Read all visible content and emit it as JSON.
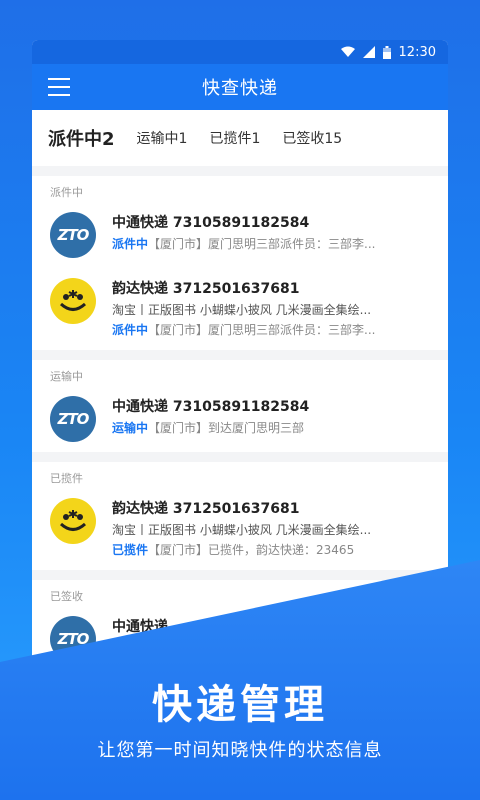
{
  "status_bar": {
    "time": "12:30"
  },
  "app": {
    "title": "快查快递"
  },
  "tabs": [
    {
      "label": "派件中2"
    },
    {
      "label": "运输中1"
    },
    {
      "label": "已揽件1"
    },
    {
      "label": "已签收15"
    }
  ],
  "sections": [
    {
      "title": "派件中",
      "items": [
        {
          "logo": "ZTO",
          "name": "中通快递 73105891182584",
          "status": "派件中",
          "location": "【厦门市】",
          "detail": "厦门思明三部派件员：三部李..."
        },
        {
          "logo": "Yunda",
          "name": "韵达快递 3712501637681",
          "desc": "淘宝丨正版图书  小蝴蝶小披风  几米漫画全集绘...",
          "status": "派件中",
          "location": "【厦门市】",
          "detail": "厦门思明三部派件员：三部李..."
        }
      ]
    },
    {
      "title": "运输中",
      "items": [
        {
          "logo": "ZTO",
          "name": "中通快递 73105891182584",
          "status": "运输中",
          "location": "【厦门市】",
          "detail": "到达厦门思明三部"
        }
      ]
    },
    {
      "title": "已揽件",
      "items": [
        {
          "logo": "Yunda",
          "name": "韵达快递 3712501637681",
          "desc": "淘宝丨正版图书  小蝴蝶小披风  几米漫画全集绘...",
          "status": "已揽件",
          "location": "【厦门市】",
          "detail": "已揽件，韵达快递：23465"
        }
      ]
    },
    {
      "title": "已签收",
      "items": [
        {
          "logo": "ZTO",
          "name": "中通快递"
        }
      ]
    }
  ],
  "promo": {
    "headline": "快递管理",
    "subtitle": "让您第一时间知晓快件的状态信息"
  },
  "colors": {
    "primary": "#1976f2",
    "zto": "#2f6fa8",
    "yunda": "#f3d51a"
  }
}
